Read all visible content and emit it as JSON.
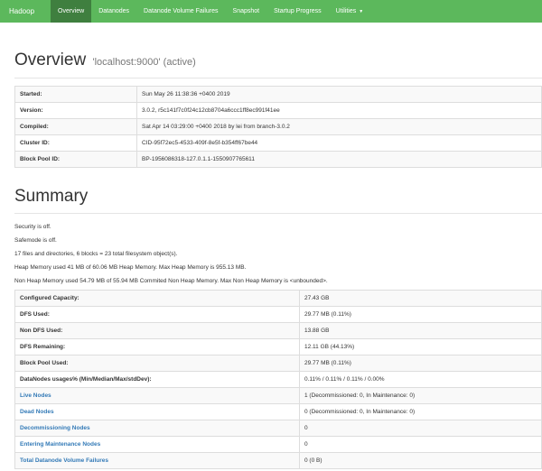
{
  "navbar": {
    "brand": "Hadoop",
    "items": [
      "Overview",
      "Datanodes",
      "Datanode Volume Failures",
      "Snapshot",
      "Startup Progress",
      "Utilities"
    ]
  },
  "overview": {
    "title": "Overview",
    "subtitle": "'localhost:9000' (active)",
    "rows": [
      {
        "label": "Started:",
        "value": "Sun May 26 11:38:36 +0400 2019"
      },
      {
        "label": "Version:",
        "value": "3.0.2, r5c141f7c0f24c12cb8704a6ccc1ff8ec991f41ee"
      },
      {
        "label": "Compiled:",
        "value": "Sat Apr 14 03:29:00 +0400 2018 by lei from branch-3.0.2"
      },
      {
        "label": "Cluster ID:",
        "value": "CID-95f72ec5-4533-409f-8e5f-b354ff67be44"
      },
      {
        "label": "Block Pool ID:",
        "value": "BP-1956086318-127.0.1.1-1550907765611"
      }
    ]
  },
  "summary": {
    "title": "Summary",
    "lines": [
      "Security is off.",
      "Safemode is off.",
      "17 files and directories, 6 blocks = 23 total filesystem object(s).",
      "Heap Memory used 41 MB of 60.06 MB Heap Memory. Max Heap Memory is 955.13 MB.",
      "Non Heap Memory used 54.79 MB of 55.94 MB Commited Non Heap Memory. Max Non Heap Memory is <unbounded>."
    ],
    "rows": [
      {
        "label": "Configured Capacity:",
        "value": "27.43 GB",
        "link": false
      },
      {
        "label": "DFS Used:",
        "value": "29.77 MB (0.11%)",
        "link": false
      },
      {
        "label": "Non DFS Used:",
        "value": "13.88 GB",
        "link": false
      },
      {
        "label": "DFS Remaining:",
        "value": "12.11 GB (44.13%)",
        "link": false
      },
      {
        "label": "Block Pool Used:",
        "value": "29.77 MB (0.11%)",
        "link": false
      },
      {
        "label": "DataNodes usages% (Min/Median/Max/stdDev):",
        "value": "0.11% / 0.11% / 0.11% / 0.00%",
        "link": false
      },
      {
        "label": "Live Nodes",
        "value": "1 (Decommissioned: 0, In Maintenance: 0)",
        "link": true
      },
      {
        "label": "Dead Nodes",
        "value": "0 (Decommissioned: 0, In Maintenance: 0)",
        "link": true
      },
      {
        "label": "Decommissioning Nodes",
        "value": "0",
        "link": true
      },
      {
        "label": "Entering Maintenance Nodes",
        "value": "0",
        "link": true
      },
      {
        "label": "Total Datanode Volume Failures",
        "value": "0 (0 B)",
        "link": true
      }
    ]
  },
  "colors": {
    "navbar": "#5cb85c",
    "navbar_active": "#3f7f3f",
    "link": "#337ab7"
  }
}
